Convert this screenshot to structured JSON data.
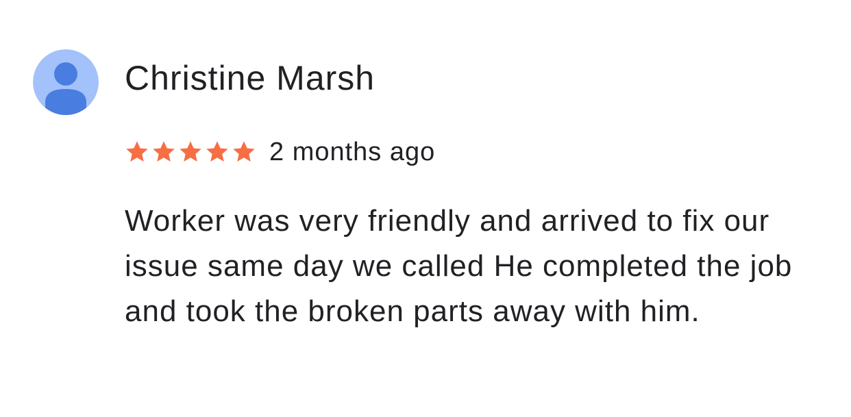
{
  "review": {
    "reviewer_name": "Christine Marsh",
    "avatar_icon": "person-icon",
    "avatar_colors": {
      "background": "#a3c1fa",
      "figure": "#4a7de0"
    },
    "rating": 5,
    "rating_max": 5,
    "star_color": "#f76e44",
    "time_ago": "2 months ago",
    "text": "Worker was very friendly and arrived to fix our issue same day we called He completed the job and took the broken parts away with him."
  }
}
